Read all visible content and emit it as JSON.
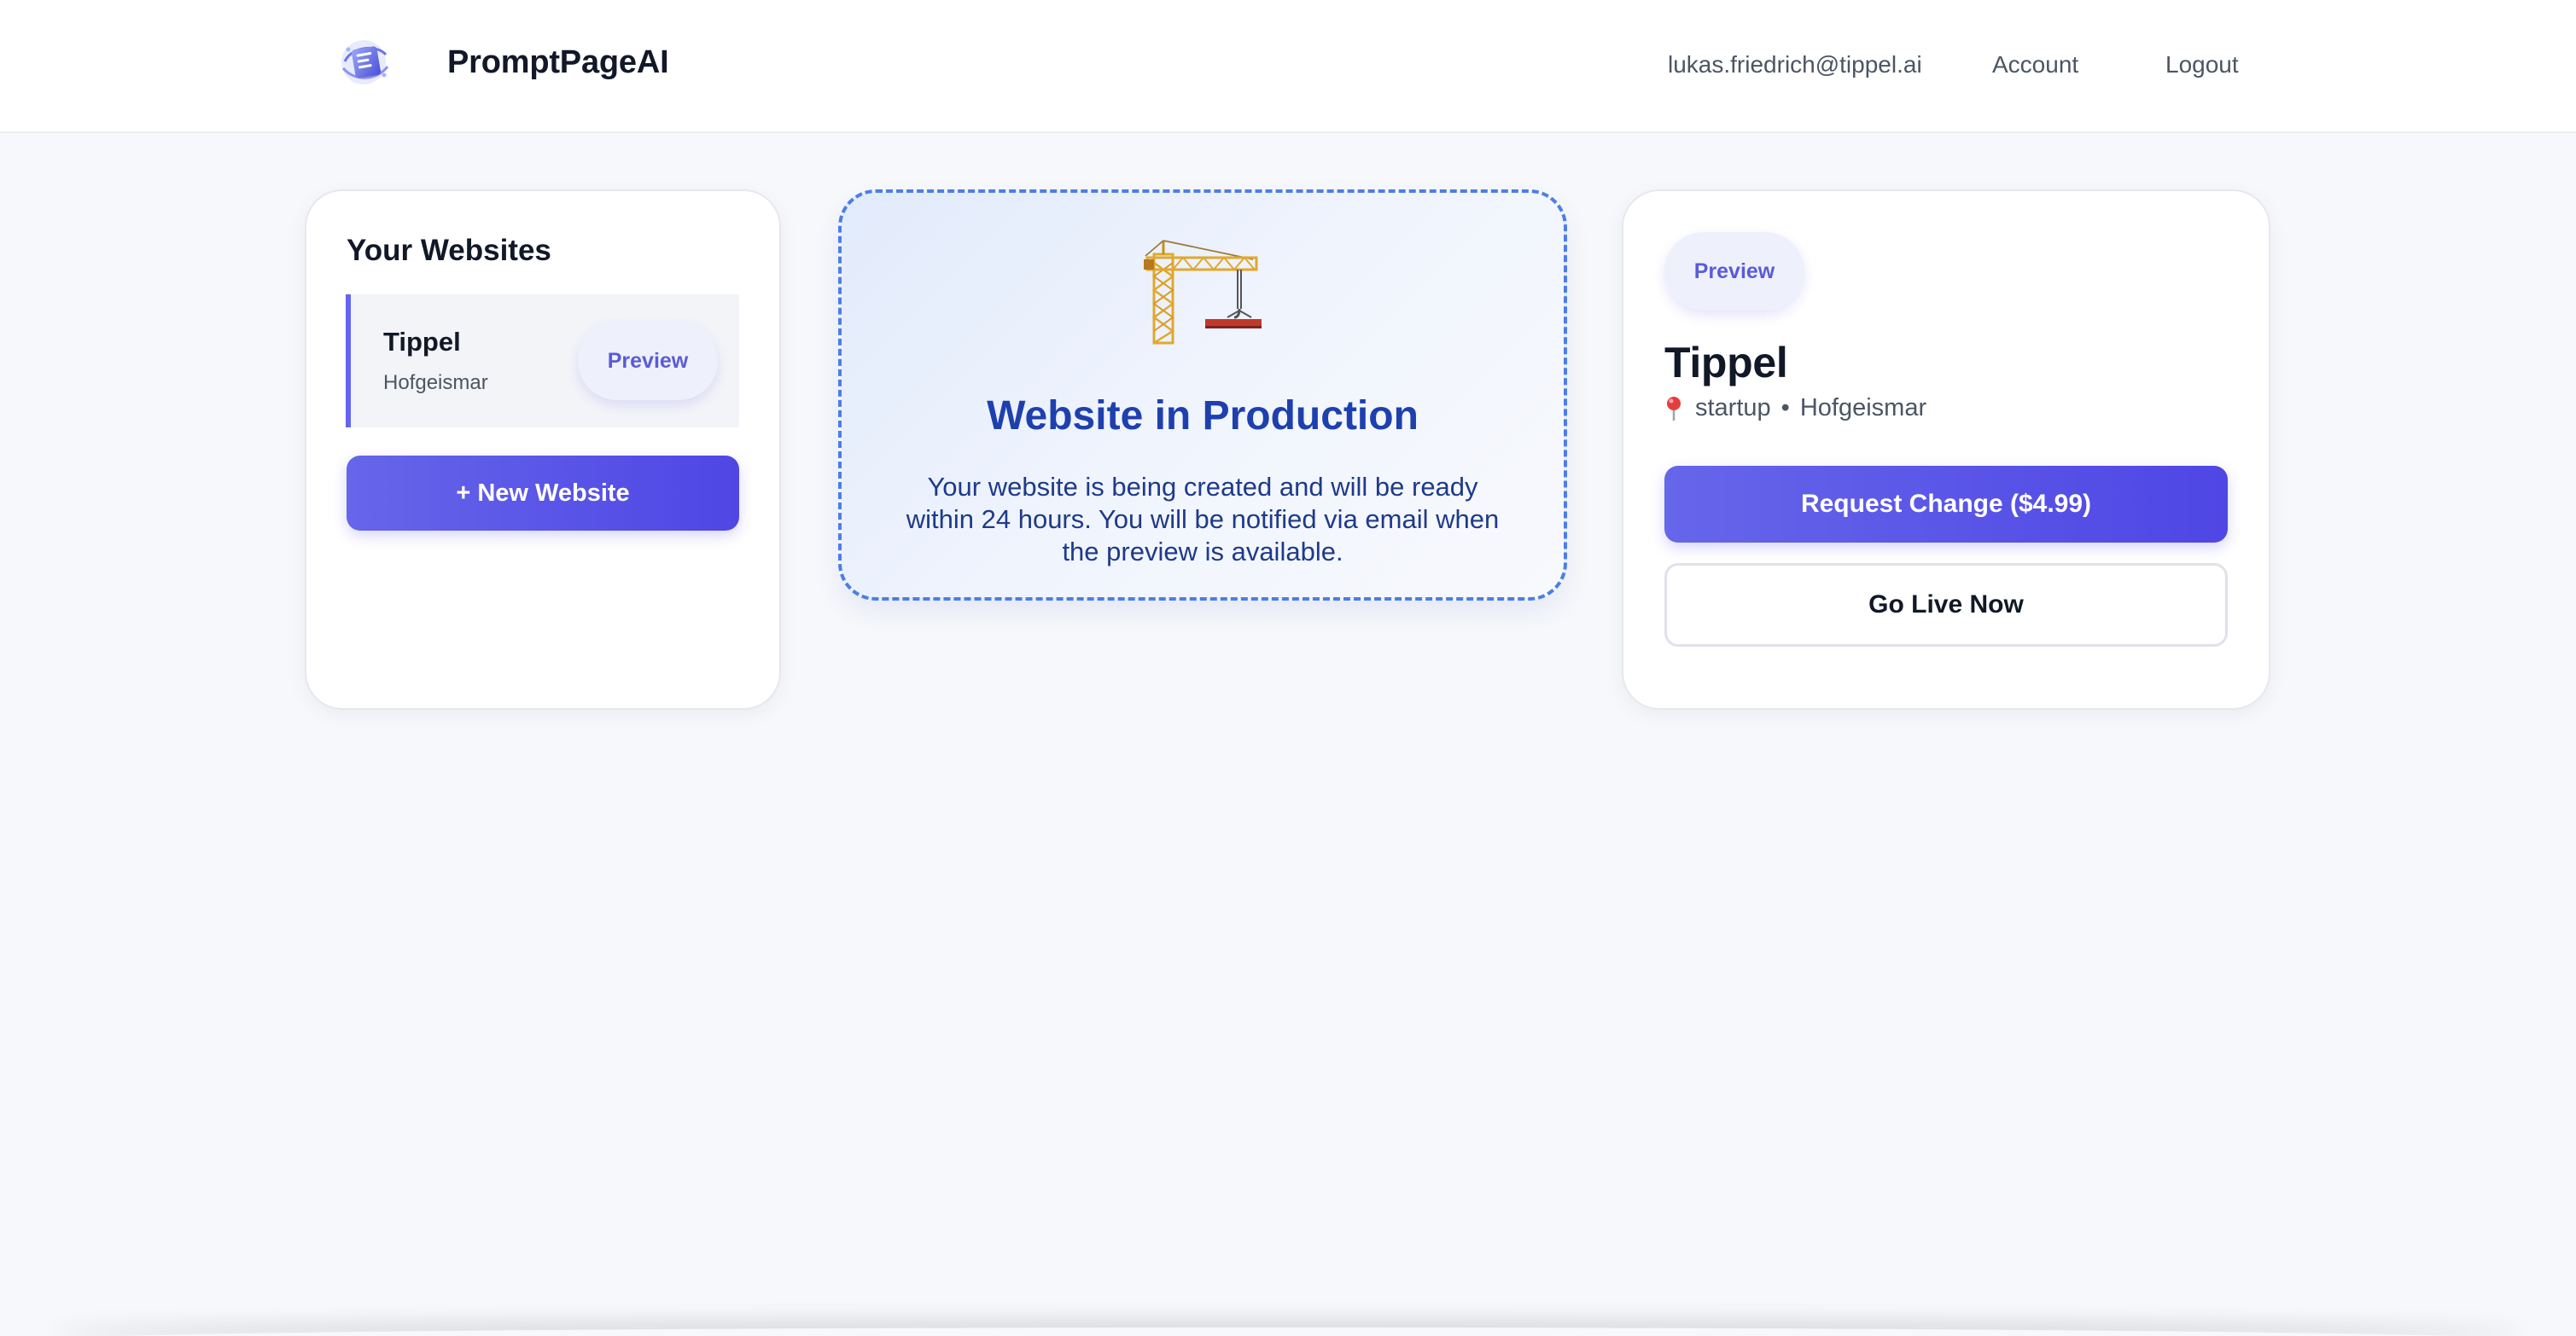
{
  "header": {
    "brand": "PromptPageAI",
    "email": "lukas.friedrich@tippel.ai",
    "account_label": "Account",
    "logout_label": "Logout"
  },
  "sidebar": {
    "title": "Your Websites",
    "sites": [
      {
        "name": "Tippel",
        "city": "Hofgeismar",
        "preview_label": "Preview"
      }
    ],
    "new_website_label": "+ New Website"
  },
  "production": {
    "icon": "construction-crane-icon",
    "title": "Website in Production",
    "message": "Your website is being created and will be ready within 24 hours. You will be notified via email when the preview is available."
  },
  "details": {
    "preview_label": "Preview",
    "title": "Tippel",
    "category": "startup",
    "separator": "•",
    "city": "Hofgeismar",
    "request_change_label": "Request Change ($4.99)",
    "go_live_label": "Go Live Now"
  },
  "colors": {
    "accent": "#4f46e5",
    "production_title": "#1e40af",
    "production_border": "#4c7ee6",
    "background": "#f7f8fb"
  }
}
